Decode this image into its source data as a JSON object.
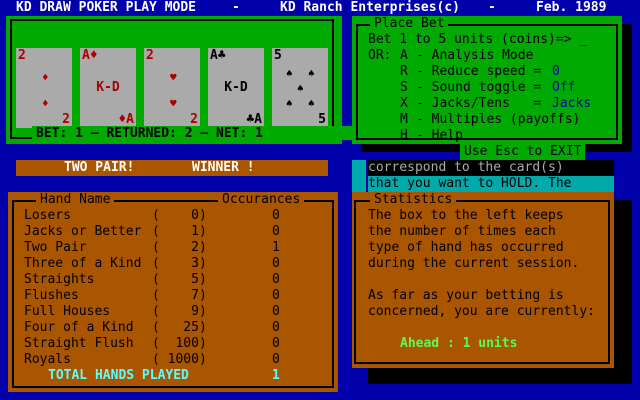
{
  "title_bar": {
    "left": "KD DRAW POKER PLAY MODE",
    "dash1": "-",
    "center": "KD Ranch Enterprises(c)",
    "dash2": "-",
    "date": "Feb. 1989"
  },
  "cards": [
    {
      "rank": "2",
      "suit": "♦",
      "center": "",
      "color": "red"
    },
    {
      "rank": "A♦",
      "suit": "♦",
      "center": "K-D",
      "color": "red",
      "br": "♦A"
    },
    {
      "rank": "2",
      "suit": "♥",
      "center": "",
      "color": "red"
    },
    {
      "rank": "A♣",
      "suit": "♣",
      "center": "K-D",
      "color": "black",
      "br": "♣A"
    },
    {
      "rank": "5",
      "suit": "♠",
      "center": "",
      "color": "black"
    }
  ],
  "bet_line": "BET: 1 — RETURNED: 2 — NET: 1",
  "result": {
    "hand": "TWO PAIR!",
    "status": "WINNER !"
  },
  "place_bet": {
    "title": "Place Bet",
    "prompt": "Bet 1 to 5 units (coins)=> _",
    "options": [
      {
        "prefix": "OR:",
        "key": "A",
        "label": "- Analysis Mode",
        "value": ""
      },
      {
        "prefix": "",
        "key": "R",
        "label": "- Reduce speed =",
        "value": "0"
      },
      {
        "prefix": "",
        "key": "S",
        "label": "- Sound toggle =",
        "value": "Off"
      },
      {
        "prefix": "",
        "key": "X",
        "label": "- Jacks/Tens   =",
        "value": "Jacks"
      },
      {
        "prefix": "",
        "key": "M",
        "label": "- Multiples (payoffs)",
        "value": ""
      },
      {
        "prefix": "",
        "key": "H",
        "label": "- Help",
        "value": ""
      }
    ],
    "esc": "Use Esc to EXIT"
  },
  "instructions": {
    "line1": "correspond to the card(s)",
    "line2": "that you want to HOLD. The"
  },
  "statistics": {
    "title": "Statistics",
    "lines": [
      "The box to the left keeps",
      "the number of times each",
      "type of hand has occurred",
      "during the current session.",
      "",
      "As far as your betting is",
      "concerned, you are currently:"
    ],
    "status": "Ahead : 1 units"
  },
  "hand_table": {
    "header_name": "Hand Name",
    "header_count": "Occurances",
    "rows": [
      {
        "name": "Losers",
        "payout": "(    0)",
        "count": "0"
      },
      {
        "name": "Jacks or Better",
        "payout": "(    1)",
        "count": "0"
      },
      {
        "name": "Two Pair",
        "payout": "(    2)",
        "count": "1"
      },
      {
        "name": "Three of a Kind",
        "payout": "(    3)",
        "count": "0"
      },
      {
        "name": "Straights",
        "payout": "(    5)",
        "count": "0"
      },
      {
        "name": "Flushes",
        "payout": "(    7)",
        "count": "0"
      },
      {
        "name": "Full Houses",
        "payout": "(    9)",
        "count": "0"
      },
      {
        "name": "Four of a Kind",
        "payout": "(   25)",
        "count": "0"
      },
      {
        "name": "Straight Flush",
        "payout": "(  100)",
        "count": "0"
      },
      {
        "name": "Royals",
        "payout": "( 1000)",
        "count": "0"
      }
    ],
    "total_label": "TOTAL HANDS PLAYED",
    "total_value": "1"
  },
  "colors": {
    "background": "#0000aa",
    "panel_green": "#00aa00",
    "panel_brown": "#aa5500",
    "card": "#aaaaaa",
    "highlight_yellow": "#ffff55",
    "highlight_cyan": "#55ffff",
    "value_blue": "#0000aa",
    "ahead_green": "#55ff55"
  }
}
